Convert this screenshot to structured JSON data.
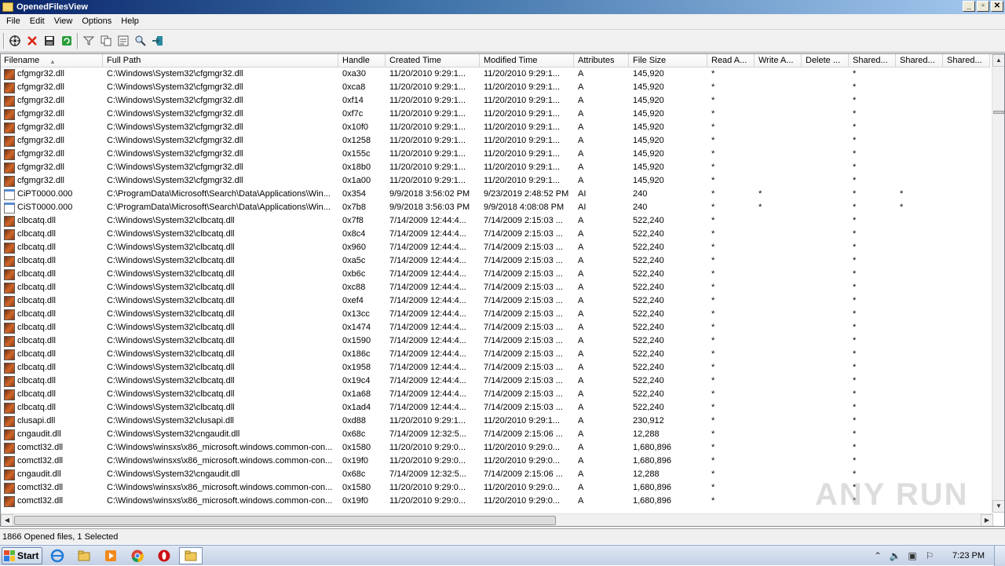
{
  "window": {
    "title": "OpenedFilesView",
    "buttons": [
      "_",
      "▫",
      "✕"
    ]
  },
  "menu": [
    "File",
    "Edit",
    "View",
    "Options",
    "Help"
  ],
  "toolbar_icons": [
    "properties-icon",
    "close-handle-icon",
    "save-icon",
    "refresh-icon",
    "filter-icon",
    "copy-icon",
    "html-report-icon",
    "find-icon",
    "exit-icon"
  ],
  "columns": [
    "Filename",
    "Full Path",
    "Handle",
    "Created Time",
    "Modified Time",
    "Attributes",
    "File Size",
    "Read A...",
    "Write A...",
    "Delete ...",
    "Shared...",
    "Shared...",
    "Shared..."
  ],
  "rows": [
    {
      "icon": "dll",
      "name": "cfgmgr32.dll",
      "path": "C:\\Windows\\System32\\cfgmgr32.dll",
      "handle": "0xa30",
      "created": "11/20/2010 9:29:1...",
      "modified": "11/20/2010 9:29:1...",
      "attr": "A",
      "size": "145,920",
      "r": "*",
      "w": "",
      "d": "",
      "s1": "*",
      "s2": "",
      "s3": ""
    },
    {
      "icon": "dll",
      "name": "cfgmgr32.dll",
      "path": "C:\\Windows\\System32\\cfgmgr32.dll",
      "handle": "0xca8",
      "created": "11/20/2010 9:29:1...",
      "modified": "11/20/2010 9:29:1...",
      "attr": "A",
      "size": "145,920",
      "r": "*",
      "w": "",
      "d": "",
      "s1": "*",
      "s2": "",
      "s3": ""
    },
    {
      "icon": "dll",
      "name": "cfgmgr32.dll",
      "path": "C:\\Windows\\System32\\cfgmgr32.dll",
      "handle": "0xf14",
      "created": "11/20/2010 9:29:1...",
      "modified": "11/20/2010 9:29:1...",
      "attr": "A",
      "size": "145,920",
      "r": "*",
      "w": "",
      "d": "",
      "s1": "*",
      "s2": "",
      "s3": ""
    },
    {
      "icon": "dll",
      "name": "cfgmgr32.dll",
      "path": "C:\\Windows\\System32\\cfgmgr32.dll",
      "handle": "0xf7c",
      "created": "11/20/2010 9:29:1...",
      "modified": "11/20/2010 9:29:1...",
      "attr": "A",
      "size": "145,920",
      "r": "*",
      "w": "",
      "d": "",
      "s1": "*",
      "s2": "",
      "s3": ""
    },
    {
      "icon": "dll",
      "name": "cfgmgr32.dll",
      "path": "C:\\Windows\\System32\\cfgmgr32.dll",
      "handle": "0x10f0",
      "created": "11/20/2010 9:29:1...",
      "modified": "11/20/2010 9:29:1...",
      "attr": "A",
      "size": "145,920",
      "r": "*",
      "w": "",
      "d": "",
      "s1": "*",
      "s2": "",
      "s3": ""
    },
    {
      "icon": "dll",
      "name": "cfgmgr32.dll",
      "path": "C:\\Windows\\System32\\cfgmgr32.dll",
      "handle": "0x1258",
      "created": "11/20/2010 9:29:1...",
      "modified": "11/20/2010 9:29:1...",
      "attr": "A",
      "size": "145,920",
      "r": "*",
      "w": "",
      "d": "",
      "s1": "*",
      "s2": "",
      "s3": ""
    },
    {
      "icon": "dll",
      "name": "cfgmgr32.dll",
      "path": "C:\\Windows\\System32\\cfgmgr32.dll",
      "handle": "0x155c",
      "created": "11/20/2010 9:29:1...",
      "modified": "11/20/2010 9:29:1...",
      "attr": "A",
      "size": "145,920",
      "r": "*",
      "w": "",
      "d": "",
      "s1": "*",
      "s2": "",
      "s3": ""
    },
    {
      "icon": "dll",
      "name": "cfgmgr32.dll",
      "path": "C:\\Windows\\System32\\cfgmgr32.dll",
      "handle": "0x18b0",
      "created": "11/20/2010 9:29:1...",
      "modified": "11/20/2010 9:29:1...",
      "attr": "A",
      "size": "145,920",
      "r": "*",
      "w": "",
      "d": "",
      "s1": "*",
      "s2": "",
      "s3": ""
    },
    {
      "icon": "dll",
      "name": "cfgmgr32.dll",
      "path": "C:\\Windows\\System32\\cfgmgr32.dll",
      "handle": "0x1a00",
      "created": "11/20/2010 9:29:1...",
      "modified": "11/20/2010 9:29:1...",
      "attr": "A",
      "size": "145,920",
      "r": "*",
      "w": "",
      "d": "",
      "s1": "*",
      "s2": "",
      "s3": ""
    },
    {
      "icon": "gen",
      "name": "CiPT0000.000",
      "path": "C:\\ProgramData\\Microsoft\\Search\\Data\\Applications\\Win...",
      "handle": "0x354",
      "created": "9/9/2018 3:56:02 PM",
      "modified": "9/23/2019 2:48:52 PM",
      "attr": "AI",
      "size": "240",
      "r": "*",
      "w": "*",
      "d": "",
      "s1": "*",
      "s2": "*",
      "s3": ""
    },
    {
      "icon": "gen",
      "name": "CiST0000.000",
      "path": "C:\\ProgramData\\Microsoft\\Search\\Data\\Applications\\Win...",
      "handle": "0x7b8",
      "created": "9/9/2018 3:56:03 PM",
      "modified": "9/9/2018 4:08:08 PM",
      "attr": "AI",
      "size": "240",
      "r": "*",
      "w": "*",
      "d": "",
      "s1": "*",
      "s2": "*",
      "s3": ""
    },
    {
      "icon": "dll",
      "name": "clbcatq.dll",
      "path": "C:\\Windows\\System32\\clbcatq.dll",
      "handle": "0x7f8",
      "created": "7/14/2009 12:44:4...",
      "modified": "7/14/2009 2:15:03 ...",
      "attr": "A",
      "size": "522,240",
      "r": "*",
      "w": "",
      "d": "",
      "s1": "*",
      "s2": "",
      "s3": ""
    },
    {
      "icon": "dll",
      "name": "clbcatq.dll",
      "path": "C:\\Windows\\System32\\clbcatq.dll",
      "handle": "0x8c4",
      "created": "7/14/2009 12:44:4...",
      "modified": "7/14/2009 2:15:03 ...",
      "attr": "A",
      "size": "522,240",
      "r": "*",
      "w": "",
      "d": "",
      "s1": "*",
      "s2": "",
      "s3": ""
    },
    {
      "icon": "dll",
      "name": "clbcatq.dll",
      "path": "C:\\Windows\\System32\\clbcatq.dll",
      "handle": "0x960",
      "created": "7/14/2009 12:44:4...",
      "modified": "7/14/2009 2:15:03 ...",
      "attr": "A",
      "size": "522,240",
      "r": "*",
      "w": "",
      "d": "",
      "s1": "*",
      "s2": "",
      "s3": ""
    },
    {
      "icon": "dll",
      "name": "clbcatq.dll",
      "path": "C:\\Windows\\System32\\clbcatq.dll",
      "handle": "0xa5c",
      "created": "7/14/2009 12:44:4...",
      "modified": "7/14/2009 2:15:03 ...",
      "attr": "A",
      "size": "522,240",
      "r": "*",
      "w": "",
      "d": "",
      "s1": "*",
      "s2": "",
      "s3": ""
    },
    {
      "icon": "dll",
      "name": "clbcatq.dll",
      "path": "C:\\Windows\\System32\\clbcatq.dll",
      "handle": "0xb6c",
      "created": "7/14/2009 12:44:4...",
      "modified": "7/14/2009 2:15:03 ...",
      "attr": "A",
      "size": "522,240",
      "r": "*",
      "w": "",
      "d": "",
      "s1": "*",
      "s2": "",
      "s3": ""
    },
    {
      "icon": "dll",
      "name": "clbcatq.dll",
      "path": "C:\\Windows\\System32\\clbcatq.dll",
      "handle": "0xc88",
      "created": "7/14/2009 12:44:4...",
      "modified": "7/14/2009 2:15:03 ...",
      "attr": "A",
      "size": "522,240",
      "r": "*",
      "w": "",
      "d": "",
      "s1": "*",
      "s2": "",
      "s3": ""
    },
    {
      "icon": "dll",
      "name": "clbcatq.dll",
      "path": "C:\\Windows\\System32\\clbcatq.dll",
      "handle": "0xef4",
      "created": "7/14/2009 12:44:4...",
      "modified": "7/14/2009 2:15:03 ...",
      "attr": "A",
      "size": "522,240",
      "r": "*",
      "w": "",
      "d": "",
      "s1": "*",
      "s2": "",
      "s3": ""
    },
    {
      "icon": "dll",
      "name": "clbcatq.dll",
      "path": "C:\\Windows\\System32\\clbcatq.dll",
      "handle": "0x13cc",
      "created": "7/14/2009 12:44:4...",
      "modified": "7/14/2009 2:15:03 ...",
      "attr": "A",
      "size": "522,240",
      "r": "*",
      "w": "",
      "d": "",
      "s1": "*",
      "s2": "",
      "s3": ""
    },
    {
      "icon": "dll",
      "name": "clbcatq.dll",
      "path": "C:\\Windows\\System32\\clbcatq.dll",
      "handle": "0x1474",
      "created": "7/14/2009 12:44:4...",
      "modified": "7/14/2009 2:15:03 ...",
      "attr": "A",
      "size": "522,240",
      "r": "*",
      "w": "",
      "d": "",
      "s1": "*",
      "s2": "",
      "s3": ""
    },
    {
      "icon": "dll",
      "name": "clbcatq.dll",
      "path": "C:\\Windows\\System32\\clbcatq.dll",
      "handle": "0x1590",
      "created": "7/14/2009 12:44:4...",
      "modified": "7/14/2009 2:15:03 ...",
      "attr": "A",
      "size": "522,240",
      "r": "*",
      "w": "",
      "d": "",
      "s1": "*",
      "s2": "",
      "s3": ""
    },
    {
      "icon": "dll",
      "name": "clbcatq.dll",
      "path": "C:\\Windows\\System32\\clbcatq.dll",
      "handle": "0x186c",
      "created": "7/14/2009 12:44:4...",
      "modified": "7/14/2009 2:15:03 ...",
      "attr": "A",
      "size": "522,240",
      "r": "*",
      "w": "",
      "d": "",
      "s1": "*",
      "s2": "",
      "s3": ""
    },
    {
      "icon": "dll",
      "name": "clbcatq.dll",
      "path": "C:\\Windows\\System32\\clbcatq.dll",
      "handle": "0x1958",
      "created": "7/14/2009 12:44:4...",
      "modified": "7/14/2009 2:15:03 ...",
      "attr": "A",
      "size": "522,240",
      "r": "*",
      "w": "",
      "d": "",
      "s1": "*",
      "s2": "",
      "s3": ""
    },
    {
      "icon": "dll",
      "name": "clbcatq.dll",
      "path": "C:\\Windows\\System32\\clbcatq.dll",
      "handle": "0x19c4",
      "created": "7/14/2009 12:44:4...",
      "modified": "7/14/2009 2:15:03 ...",
      "attr": "A",
      "size": "522,240",
      "r": "*",
      "w": "",
      "d": "",
      "s1": "*",
      "s2": "",
      "s3": ""
    },
    {
      "icon": "dll",
      "name": "clbcatq.dll",
      "path": "C:\\Windows\\System32\\clbcatq.dll",
      "handle": "0x1a68",
      "created": "7/14/2009 12:44:4...",
      "modified": "7/14/2009 2:15:03 ...",
      "attr": "A",
      "size": "522,240",
      "r": "*",
      "w": "",
      "d": "",
      "s1": "*",
      "s2": "",
      "s3": ""
    },
    {
      "icon": "dll",
      "name": "clbcatq.dll",
      "path": "C:\\Windows\\System32\\clbcatq.dll",
      "handle": "0x1ad4",
      "created": "7/14/2009 12:44:4...",
      "modified": "7/14/2009 2:15:03 ...",
      "attr": "A",
      "size": "522,240",
      "r": "*",
      "w": "",
      "d": "",
      "s1": "*",
      "s2": "",
      "s3": ""
    },
    {
      "icon": "dll",
      "name": "clusapi.dll",
      "path": "C:\\Windows\\System32\\clusapi.dll",
      "handle": "0xd88",
      "created": "11/20/2010 9:29:1...",
      "modified": "11/20/2010 9:29:1...",
      "attr": "A",
      "size": "230,912",
      "r": "*",
      "w": "",
      "d": "",
      "s1": "*",
      "s2": "",
      "s3": ""
    },
    {
      "icon": "dll",
      "name": "cngaudit.dll",
      "path": "C:\\Windows\\System32\\cngaudit.dll",
      "handle": "0x68c",
      "created": "7/14/2009 12:32:5...",
      "modified": "7/14/2009 2:15:06 ...",
      "attr": "A",
      "size": "12,288",
      "r": "*",
      "w": "",
      "d": "",
      "s1": "*",
      "s2": "",
      "s3": ""
    },
    {
      "icon": "dll",
      "name": "comctl32.dll",
      "path": "C:\\Windows\\winsxs\\x86_microsoft.windows.common-con...",
      "handle": "0x1580",
      "created": "11/20/2010 9:29:0...",
      "modified": "11/20/2010 9:29:0...",
      "attr": "A",
      "size": "1,680,896",
      "r": "*",
      "w": "",
      "d": "",
      "s1": "*",
      "s2": "",
      "s3": ""
    },
    {
      "icon": "dll",
      "name": "comctl32.dll",
      "path": "C:\\Windows\\winsxs\\x86_microsoft.windows.common-con...",
      "handle": "0x19f0",
      "created": "11/20/2010 9:29:0...",
      "modified": "11/20/2010 9:29:0...",
      "attr": "A",
      "size": "1,680,896",
      "r": "*",
      "w": "",
      "d": "",
      "s1": "*",
      "s2": "",
      "s3": ""
    },
    {
      "icon": "dll",
      "name": "cngaudit.dll",
      "path": "C:\\Windows\\System32\\cngaudit.dll",
      "handle": "0x68c",
      "created": "7/14/2009 12:32:5...",
      "modified": "7/14/2009 2:15:06 ...",
      "attr": "A",
      "size": "12,288",
      "r": "*",
      "w": "",
      "d": "",
      "s1": "*",
      "s2": "",
      "s3": ""
    },
    {
      "icon": "dll",
      "name": "comctl32.dll",
      "path": "C:\\Windows\\winsxs\\x86_microsoft.windows.common-con...",
      "handle": "0x1580",
      "created": "11/20/2010 9:29:0...",
      "modified": "11/20/2010 9:29:0...",
      "attr": "A",
      "size": "1,680,896",
      "r": "*",
      "w": "",
      "d": "",
      "s1": "*",
      "s2": "",
      "s3": ""
    },
    {
      "icon": "dll",
      "name": "comctl32.dll",
      "path": "C:\\Windows\\winsxs\\x86_microsoft.windows.common-con...",
      "handle": "0x19f0",
      "created": "11/20/2010 9:29:0...",
      "modified": "11/20/2010 9:29:0...",
      "attr": "A",
      "size": "1,680,896",
      "r": "*",
      "w": "",
      "d": "",
      "s1": "*",
      "s2": "",
      "s3": ""
    }
  ],
  "status": "1866 Opened files, 1 Selected",
  "taskbar": {
    "start_label": "Start",
    "clock": "7:23 PM",
    "watermark": "ANY RUN"
  }
}
